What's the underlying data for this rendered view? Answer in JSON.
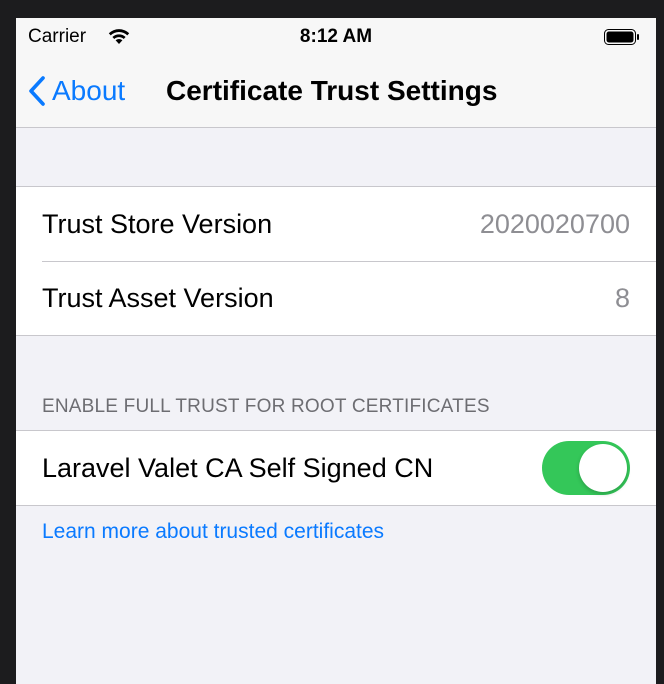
{
  "status_bar": {
    "carrier": "Carrier",
    "time": "8:12 AM"
  },
  "nav": {
    "back_label": "About",
    "title": "Certificate Trust Settings"
  },
  "versions": [
    {
      "label": "Trust Store Version",
      "value": "2020020700"
    },
    {
      "label": "Trust Asset Version",
      "value": "8"
    }
  ],
  "trust_section": {
    "header": "ENABLE FULL TRUST FOR ROOT CERTIFICATES",
    "items": [
      {
        "label": "Laravel Valet CA Self Signed CN",
        "enabled": true
      }
    ],
    "footer_link": "Learn more about trusted certificates"
  },
  "colors": {
    "accent": "#0a7aff",
    "toggle_on": "#34c759",
    "background": "#f2f2f7"
  }
}
